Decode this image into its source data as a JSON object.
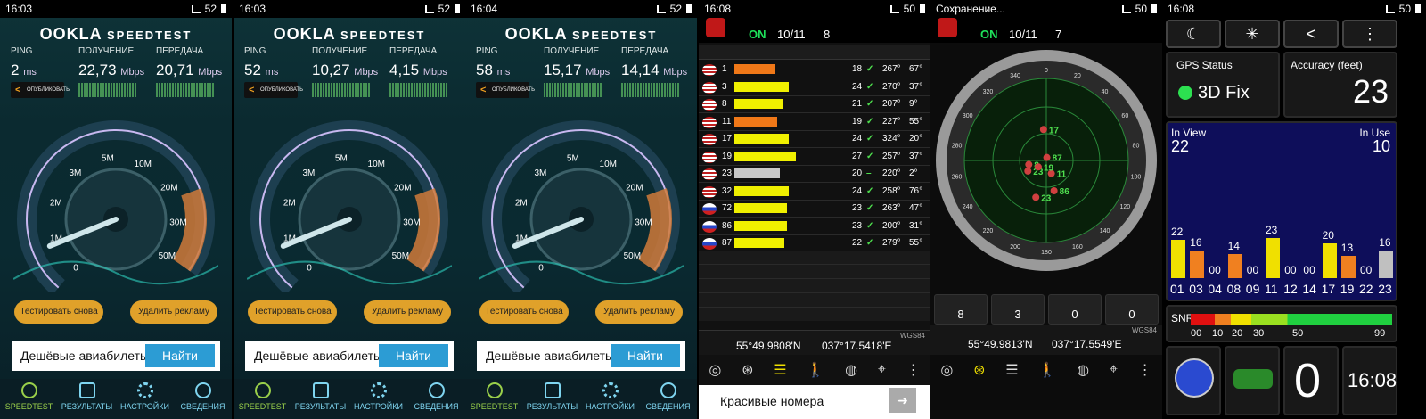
{
  "speedtest": [
    {
      "time": "16:03",
      "battery": "52",
      "ping": "2",
      "down": "22,73",
      "up": "20,71"
    },
    {
      "time": "16:03",
      "battery": "52",
      "ping": "52",
      "down": "10,27",
      "up": "4,15"
    },
    {
      "time": "16:04",
      "battery": "52",
      "ping": "58",
      "down": "15,17",
      "up": "14,14"
    }
  ],
  "st_common": {
    "logo": "OOKLA",
    "logo_b": "SPEEDTEST",
    "ping_label": "PING",
    "down_label": "ПОЛУЧЕНИЕ",
    "up_label": "ПЕРЕДАЧА",
    "ms": "ms",
    "mbps": "Mbps",
    "share": "ОПУБЛИКОВАТЬ",
    "retest": "Тестировать снова",
    "remove_ads": "Удалить рекламу",
    "ad_text": "Дешёвые авиабилеты:",
    "ad_btn": "Найти",
    "nav": [
      "SPEEDTEST",
      "РЕЗУЛЬТАТЫ",
      "НАСТРОЙКИ",
      "СВЕДЕНИЯ"
    ],
    "ticks": [
      "0",
      "1M",
      "2M",
      "3M",
      "5M",
      "10M",
      "20M",
      "30M",
      "50M"
    ]
  },
  "gps1": {
    "time": "16:08",
    "battery": "50",
    "on": "ON",
    "view": "10/11",
    "m": "8",
    "lat": "55°49.9808'N",
    "lon": "037°17.5418'E",
    "datum": "WGS84",
    "ad": "Красивые номера",
    "rows": [
      {
        "id": "1",
        "snr": "18",
        "az": "267°",
        "el": "67°",
        "color": "#f07818",
        "ok": "✓"
      },
      {
        "id": "3",
        "snr": "24",
        "az": "270°",
        "el": "37°",
        "color": "#f0f000",
        "ok": "✓"
      },
      {
        "id": "8",
        "snr": "21",
        "az": "207°",
        "el": "9°",
        "color": "#f0f000",
        "ok": "✓"
      },
      {
        "id": "11",
        "snr": "19",
        "az": "227°",
        "el": "55°",
        "color": "#f07818",
        "ok": "✓"
      },
      {
        "id": "17",
        "snr": "24",
        "az": "324°",
        "el": "20°",
        "color": "#f0f000",
        "ok": "✓"
      },
      {
        "id": "19",
        "snr": "27",
        "az": "257°",
        "el": "37°",
        "color": "#f0f000",
        "ok": "✓"
      },
      {
        "id": "23",
        "snr": "20",
        "az": "220°",
        "el": "2°",
        "color": "#c8c8c8",
        "ok": "–"
      },
      {
        "id": "32",
        "snr": "24",
        "az": "258°",
        "el": "76°",
        "color": "#f0f000",
        "ok": "✓"
      },
      {
        "id": "72",
        "snr": "23",
        "az": "263°",
        "el": "47°",
        "color": "#f0f000",
        "ok": "✓"
      },
      {
        "id": "86",
        "snr": "23",
        "az": "200°",
        "el": "31°",
        "color": "#f0f000",
        "ok": "✓"
      },
      {
        "id": "87",
        "snr": "22",
        "az": "279°",
        "el": "55°",
        "color": "#f0f000",
        "ok": "✓"
      }
    ]
  },
  "gps2": {
    "notice": "Сохранение...",
    "battery": "50",
    "on": "ON",
    "view": "10/11",
    "m": "7",
    "lat": "55°49.9813'N",
    "lon": "037°17.5549'E",
    "datum": "WGS84",
    "counts": [
      "8",
      "3",
      "0",
      "0"
    ],
    "sats": [
      "8",
      "23",
      "86",
      "11",
      "19",
      "23",
      "87",
      "17"
    ],
    "compass": [
      "0",
      "20",
      "40",
      "60",
      "80",
      "100",
      "120",
      "140",
      "160",
      "180",
      "200",
      "220",
      "240",
      "260",
      "280",
      "300",
      "320",
      "340"
    ]
  },
  "status": {
    "time": "16:08",
    "battery": "50",
    "gps_status": "GPS Status",
    "fix": "3D Fix",
    "accuracy_label": "Accuracy (feet)",
    "accuracy": "23",
    "in_view_label": "In View",
    "in_view": "22",
    "in_use_label": "In Use",
    "in_use": "10",
    "snr_label": "SNR",
    "snr_ticks": [
      "00",
      "10",
      "20",
      "30",
      "50",
      "99"
    ],
    "zero": "0",
    "clock": "16:08",
    "bars": [
      {
        "id": "01",
        "v": "22",
        "c": "#f0e000"
      },
      {
        "id": "03",
        "v": "16",
        "c": "#f08020"
      },
      {
        "id": "04",
        "v": "00",
        "c": "#f08020"
      },
      {
        "id": "08",
        "v": "14",
        "c": "#f08020"
      },
      {
        "id": "09",
        "v": "00",
        "c": "#f08020"
      },
      {
        "id": "11",
        "v": "23",
        "c": "#f0e000"
      },
      {
        "id": "12",
        "v": "00",
        "c": "#f08020"
      },
      {
        "id": "14",
        "v": "00",
        "c": "#f08020"
      },
      {
        "id": "17",
        "v": "20",
        "c": "#f0e000"
      },
      {
        "id": "19",
        "v": "13",
        "c": "#f08020"
      },
      {
        "id": "22",
        "v": "00",
        "c": "#f08020"
      },
      {
        "id": "23",
        "v": "16",
        "c": "#c0c0c0"
      }
    ]
  }
}
